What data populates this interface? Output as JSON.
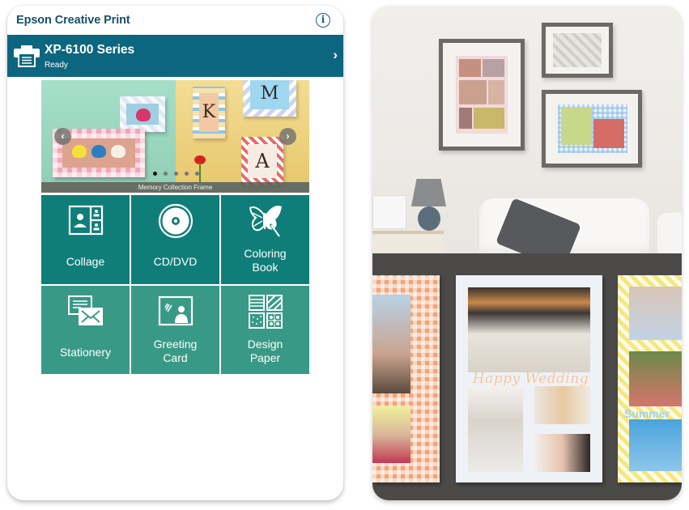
{
  "app": {
    "title": "Epson Creative Print",
    "info_icon": "info-icon",
    "info_glyph": "i"
  },
  "printer": {
    "icon": "printer-icon",
    "name": "XP-6100 Series",
    "status": "Ready",
    "chevron": "›"
  },
  "carousel": {
    "caption": "Memory Collection Frame",
    "prev_glyph": "‹",
    "next_glyph": "›",
    "slide_count": 5,
    "active_index": 0,
    "frame_letters": [
      "K",
      "M",
      "A"
    ]
  },
  "menu": {
    "items": [
      {
        "label": "Collage",
        "icon": "collage-icon"
      },
      {
        "label": "CD/DVD",
        "icon": "disc-icon"
      },
      {
        "label": "Coloring Book",
        "line1": "Coloring",
        "line2": "Book",
        "icon": "butterfly-icon"
      },
      {
        "label": "Stationery",
        "icon": "stationery-icon"
      },
      {
        "label": "Greeting Card",
        "line1": "Greeting",
        "line2": "Card",
        "icon": "greeting-card-icon"
      },
      {
        "label": "Design Paper",
        "line1": "Design",
        "line2": "Paper",
        "icon": "design-paper-icon"
      }
    ]
  },
  "showcase": {
    "wedding_text": "Happy Wedding",
    "summer_text": "Summer"
  },
  "colors": {
    "title_text": "#17516b",
    "printer_bar": "#0d6680",
    "tile_row1": "#0f7e79",
    "tile_row2": "#389a86",
    "tray": "#4c4a49"
  }
}
